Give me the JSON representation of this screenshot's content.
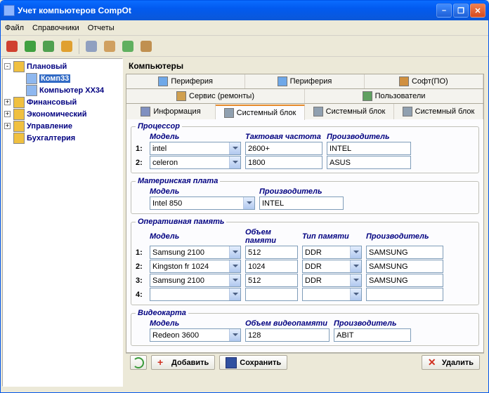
{
  "window": {
    "title": "Учет компьютеров CompOt"
  },
  "menu": {
    "file": "Файл",
    "dir": "Справочники",
    "rep": "Отчеты"
  },
  "toolbar_icons": [
    {
      "c": "#d04030"
    },
    {
      "c": "#40a040"
    },
    {
      "c": "#50a050"
    },
    {
      "c": "#e0a030"
    },
    {
      "c": "#90a0c0"
    },
    {
      "c": "#d0a060"
    },
    {
      "c": "#60b060"
    },
    {
      "c": "#c09050"
    }
  ],
  "tree": [
    {
      "exp": "-",
      "icon": "#f0c040",
      "label": "Плановый",
      "depth": 0
    },
    {
      "exp": "",
      "icon": "#8fb8ef",
      "label": "Комп33",
      "depth": 1,
      "sel": true
    },
    {
      "exp": "",
      "icon": "#8fb8ef",
      "label": "Компьютер XX34",
      "depth": 1
    },
    {
      "exp": "+",
      "icon": "#f0c040",
      "label": "Финансовый",
      "depth": 0
    },
    {
      "exp": "+",
      "icon": "#f0c040",
      "label": "Экономический",
      "depth": 0
    },
    {
      "exp": "+",
      "icon": "#f0c040",
      "label": "Управление",
      "depth": 0
    },
    {
      "exp": "",
      "icon": "#f0c040",
      "label": "Бухгалтерия",
      "depth": 0
    }
  ],
  "content_title": "Компьютеры",
  "tabs": {
    "row1": [
      {
        "icon": "#6fa8e8",
        "label": "Периферия"
      },
      {
        "icon": "#6fa8e8",
        "label": "Периферия"
      },
      {
        "icon": "#d09040",
        "label": "Софт(ПО)"
      }
    ],
    "row2": [
      {
        "icon": "#d0a050",
        "label": "Сервис (ремонты)"
      },
      {
        "icon": "#60a060",
        "label": "Пользователи"
      }
    ],
    "row3": [
      {
        "icon": "#8090c0",
        "label": "Информация"
      },
      {
        "icon": "#90a0b0",
        "label": "Системный блок",
        "active": true
      },
      {
        "icon": "#90a0b0",
        "label": "Системный блок"
      },
      {
        "icon": "#90a0b0",
        "label": "Системный блок"
      }
    ]
  },
  "cpu": {
    "legend": "Процессор",
    "h_model": "Модель",
    "h_freq": "Тактовая частота",
    "h_maker": "Производитель",
    "r1": {
      "n": "1:",
      "model": "intel",
      "freq": "2600+",
      "maker": "INTEL"
    },
    "r2": {
      "n": "2:",
      "model": "celeron",
      "freq": "1800",
      "maker": "ASUS"
    }
  },
  "mb": {
    "legend": "Материнская плата",
    "h_model": "Модель",
    "h_maker": "Производитель",
    "model": "Intel 850",
    "maker": "INTEL"
  },
  "ram": {
    "legend": "Оперативная память",
    "h_model": "Модель",
    "h_size": "Объем памяти",
    "h_type": "Тип памяти",
    "h_maker": "Производитель",
    "rows": [
      {
        "n": "1:",
        "model": "Samsung 2100",
        "size": "512",
        "type": "DDR",
        "maker": "SAMSUNG"
      },
      {
        "n": "2:",
        "model": "Kingston fr 1024",
        "size": "1024",
        "type": "DDR",
        "maker": "SAMSUNG"
      },
      {
        "n": "3:",
        "model": "Samsung 2100",
        "size": "512",
        "type": "DDR",
        "maker": "SAMSUNG"
      },
      {
        "n": "4:",
        "model": "",
        "size": "",
        "type": "",
        "maker": ""
      }
    ]
  },
  "gpu": {
    "legend": "Видеокарта",
    "h_model": "Модель",
    "h_size": "Объем видеопамяти",
    "h_maker": "Производитель",
    "model": "Redeon 3600",
    "size": "128",
    "maker": "ABIT"
  },
  "footer": {
    "add": "Добавить",
    "save": "Сохранить",
    "del": "Удалить"
  }
}
